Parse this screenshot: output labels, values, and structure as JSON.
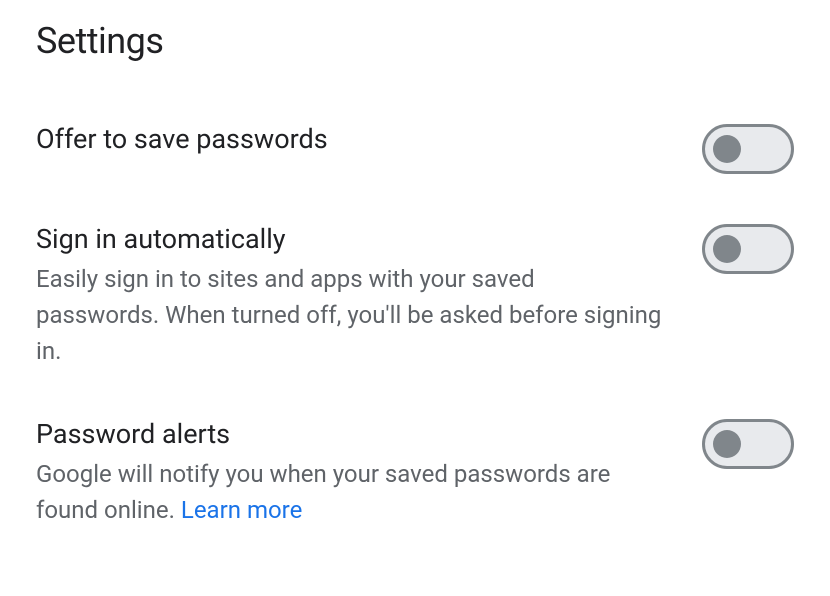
{
  "page_title": "Settings",
  "settings": {
    "offer_save": {
      "label": "Offer to save passwords",
      "enabled": false
    },
    "sign_in_auto": {
      "label": "Sign in automatically",
      "description": "Easily sign in to sites and apps with your saved passwords. When turned off, you'll be asked before signing in.",
      "enabled": false
    },
    "password_alerts": {
      "label": "Password alerts",
      "description": "Google will notify you when your saved passwords are found online. ",
      "learn_more": "Learn more",
      "enabled": false
    }
  }
}
